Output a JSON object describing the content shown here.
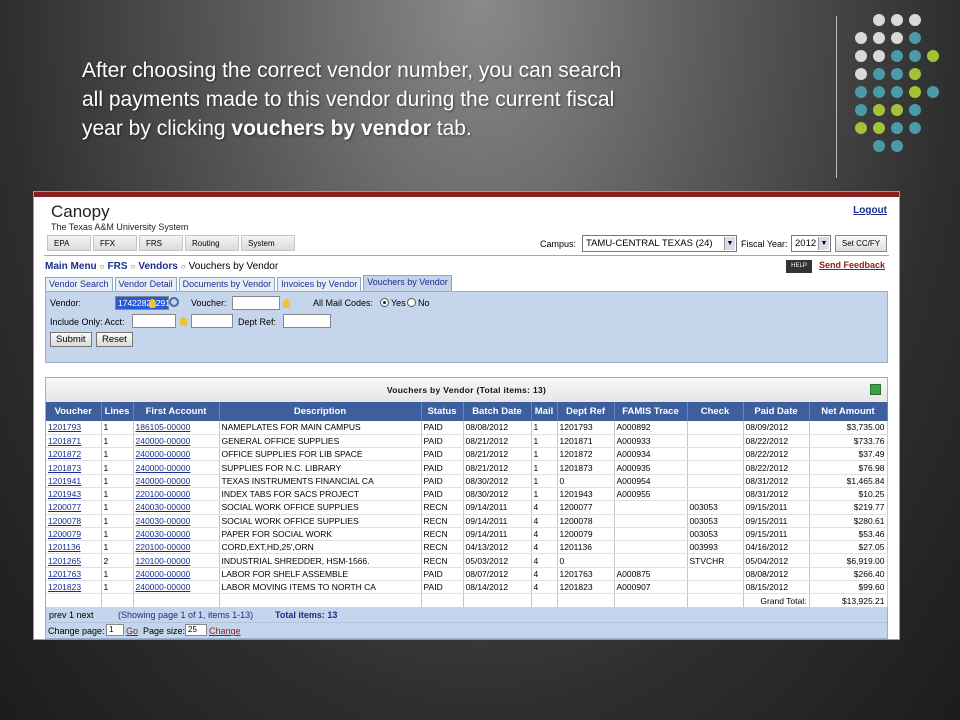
{
  "slide": {
    "line1": "After choosing the correct vendor number, you can search",
    "line2": "all payments made to this vendor during the current fiscal",
    "line3_pre": "year by clicking ",
    "line3_bold": "vouchers by vendor",
    "line3_post": " tab."
  },
  "colors": {
    "dot_gray": "#d9d9d9",
    "dot_teal": "#4a9aa8",
    "dot_lime": "#a3c23a",
    "header_blue": "#3d5f9e",
    "form_blue": "#c5d5ec",
    "brand_red": "#8c1d1d"
  },
  "app": {
    "title": "Canopy",
    "subtitle": "The Texas A&M University System",
    "logout": "Logout",
    "system_tabs": [
      "EPA",
      "FFX",
      "FRS",
      "Routing",
      "System"
    ],
    "campus_label": "Campus:",
    "campus_value": "TAMU-CENTRAL TEXAS (24)",
    "fy_label": "Fiscal Year:",
    "fy_value": "2012",
    "set_button": "Set CC/FY",
    "breadcrumb": [
      "Main Menu",
      "FRS",
      "Vendors",
      "Vouchers by Vendor"
    ],
    "help_label": "HELP",
    "feedback": "Send Feedback",
    "tabs": [
      "Vendor Search",
      "Vendor Detail",
      "Documents by Vendor",
      "Invoices by Vendor",
      "Vouchers by Vendor"
    ]
  },
  "form": {
    "vendor_label": "Vendor:",
    "vendor_value": "17422822291",
    "voucher_label": "Voucher:",
    "voucher_value": "",
    "mail_codes_label": "All Mail Codes:",
    "yes": "Yes",
    "no": "No",
    "include_label": "Include Only: Acct:",
    "dept_ref_label": "Dept Ref:",
    "submit": "Submit",
    "reset": "Reset"
  },
  "results": {
    "title": "Vouchers by Vendor (Total items: 13)",
    "columns": [
      "Voucher",
      "Lines",
      "First Account",
      "Description",
      "Status",
      "Batch Date",
      "Mail",
      "Dept Ref",
      "FAMIS Trace",
      "Check",
      "Paid Date",
      "Net Amount"
    ],
    "rows": [
      [
        "1201793",
        "1",
        "186105-00000",
        "NAMEPLATES FOR MAIN CAMPUS",
        "PAID",
        "08/08/2012",
        "1",
        "1201793",
        "A000892",
        "",
        "08/09/2012",
        "$3,735.00"
      ],
      [
        "1201871",
        "1",
        "240000-00000",
        "GENERAL OFFICE SUPPLIES",
        "PAID",
        "08/21/2012",
        "1",
        "1201871",
        "A000933",
        "",
        "08/22/2012",
        "$733.76"
      ],
      [
        "1201872",
        "1",
        "240000-00000",
        "OFFICE SUPPLIES FOR LIB SPACE",
        "PAID",
        "08/21/2012",
        "1",
        "1201872",
        "A000934",
        "",
        "08/22/2012",
        "$37.49"
      ],
      [
        "1201873",
        "1",
        "240000-00000",
        "SUPPLIES FOR N.C. LIBRARY",
        "PAID",
        "08/21/2012",
        "1",
        "1201873",
        "A000935",
        "",
        "08/22/2012",
        "$76.98"
      ],
      [
        "1201941",
        "1",
        "240000-00000",
        "TEXAS INSTRUMENTS FINANCIAL CA",
        "PAID",
        "08/30/2012",
        "1",
        "0",
        "A000954",
        "",
        "08/31/2012",
        "$1,465.84"
      ],
      [
        "1201943",
        "1",
        "220100-00000",
        "INDEX TABS FOR SACS PROJECT",
        "PAID",
        "08/30/2012",
        "1",
        "1201943",
        "A000955",
        "",
        "08/31/2012",
        "$10.25"
      ],
      [
        "1200077",
        "1",
        "240030-00000",
        "SOCIAL WORK OFFICE SUPPLIES",
        "RECN",
        "09/14/2011",
        "4",
        "1200077",
        "",
        "003053",
        "09/15/2011",
        "$219.77"
      ],
      [
        "1200078",
        "1",
        "240030-00000",
        "SOCIAL WORK OFFICE SUPPLIES",
        "RECN",
        "09/14/2011",
        "4",
        "1200078",
        "",
        "003053",
        "09/15/2011",
        "$280.61"
      ],
      [
        "1200079",
        "1",
        "240030-00000",
        "PAPER FOR SOCIAL WORK",
        "RECN",
        "09/14/2011",
        "4",
        "1200079",
        "",
        "003053",
        "09/15/2011",
        "$53.46"
      ],
      [
        "1201136",
        "1",
        "220100-00000",
        "CORD,EXT,HD,25',ORN",
        "RECN",
        "04/13/2012",
        "4",
        "1201136",
        "",
        "003993",
        "04/16/2012",
        "$27.05"
      ],
      [
        "1201265",
        "2",
        "120100-00000",
        "INDUSTRIAL SHREDDER, HSM-1566.",
        "RECN",
        "05/03/2012",
        "4",
        "0",
        "",
        "STVCHR",
        "05/04/2012",
        "$6,919.00"
      ],
      [
        "1201763",
        "1",
        "240000-00000",
        "LABOR FOR SHELF ASSEMBLE",
        "PAID",
        "08/07/2012",
        "4",
        "1201763",
        "A000875",
        "",
        "08/08/2012",
        "$266.40"
      ],
      [
        "1201823",
        "1",
        "240000-00000",
        "LABOR MOVING ITEMS TO NORTH CA",
        "PAID",
        "08/14/2012",
        "4",
        "1201823",
        "A000907",
        "",
        "08/15/2012",
        "$99.60"
      ]
    ],
    "grand_total_label": "Grand Total:",
    "grand_total": "$13,925.21",
    "pager_nav": "prev 1 next",
    "pager_showing": "(Showing page 1 of 1, items 1-13)",
    "pager_total": "Total items: 13",
    "change_page_label": "Change page:",
    "change_page_value": "1",
    "go": "Go",
    "page_size_label": "Page size:",
    "page_size_value": "25",
    "change": "Change"
  }
}
